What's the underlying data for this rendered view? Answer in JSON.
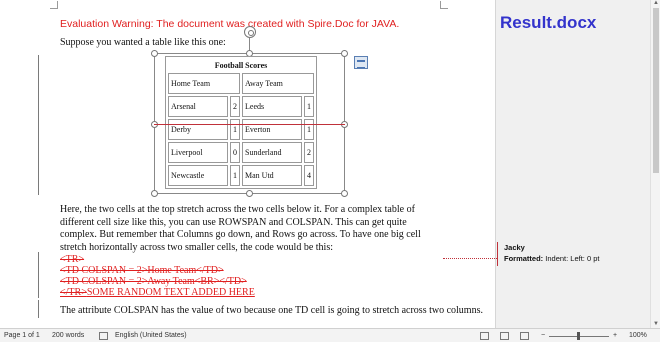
{
  "document": {
    "warning": "Evaluation Warning: The document was created with Spire.Doc for JAVA.",
    "intro": "Suppose you wanted a table like this one:",
    "body": "Here, the two cells at the top stretch across the two cells below it. For a complex table of different cell size like this, you can use ROWSPAN and COLSPAN. This can get quite complex. But remember that Columns go down, and Rows go across. To have one big cell stretch horizontally across two smaller cells, the code would be this:",
    "deleted_lines": [
      "<TR>",
      "<TD COLSPAN = 2>Home Team</TD>",
      "<TD COLSPAN = 2>Away Team<BR></TD>"
    ],
    "last_line_deleted": "</TR>",
    "last_line_inserted": "SOME RANDOM TEXT ADDED HERE",
    "closing": "The attribute COLSPAN has the value of two because one TD cell is going to stretch across two columns."
  },
  "table": {
    "title": "Football Scores",
    "header": [
      "Home Team",
      "Away Team"
    ],
    "rows": [
      [
        "Arsenal",
        "2",
        "Leeds",
        "1"
      ],
      [
        "Derby",
        "1",
        "Everton",
        "1"
      ],
      [
        "Liverpool",
        "0",
        "Sunderland",
        "2"
      ],
      [
        "Newcastle",
        "1",
        "Man Utd",
        "4"
      ]
    ]
  },
  "margin": {
    "result_title": "Result.docx",
    "comment_author": "Jacky",
    "comment_label": "Formatted:",
    "comment_text": "Indent: Left:  0 pt"
  },
  "status_bar": {
    "page": "Page 1 of 1",
    "words": "200 words",
    "language": "English (United States)",
    "zoom": "100%",
    "zoom_level": 1.0
  },
  "colors": {
    "warning": "#e02020",
    "title": "#3333cc",
    "revision": "#c0313a"
  }
}
